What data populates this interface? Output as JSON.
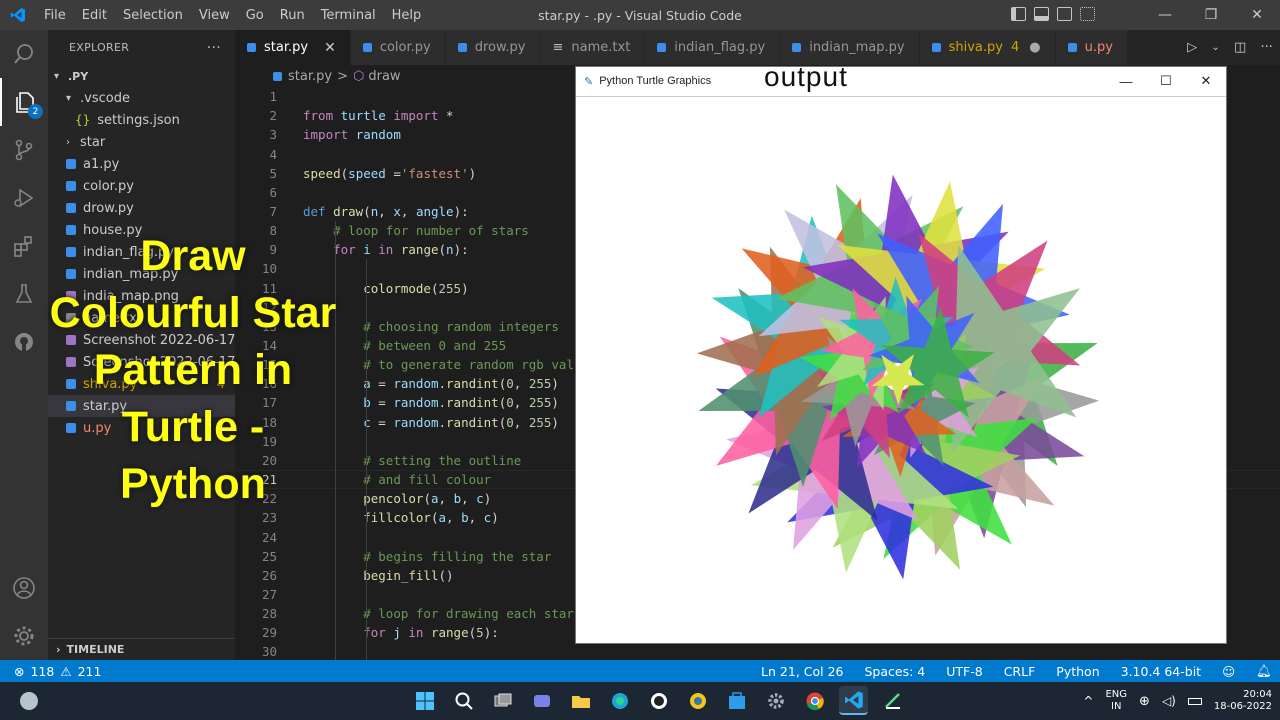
{
  "titlebar": {
    "menu": [
      "File",
      "Edit",
      "Selection",
      "View",
      "Go",
      "Run",
      "Terminal",
      "Help"
    ],
    "title": "star.py - .py - Visual Studio Code",
    "controls": {
      "minimize": "—",
      "maximize": "❐",
      "close": "✕"
    }
  },
  "activity": {
    "explorer_badge": "2"
  },
  "sidebar": {
    "header": "EXPLORER",
    "more": "···",
    "root": ".PY",
    "items": [
      {
        "label": ".vscode",
        "kind": "folder-open"
      },
      {
        "label": "settings.json",
        "kind": "json"
      },
      {
        "label": "star",
        "kind": "folder"
      },
      {
        "label": "a1.py",
        "kind": "py"
      },
      {
        "label": "color.py",
        "kind": "py"
      },
      {
        "label": "drow.py",
        "kind": "py"
      },
      {
        "label": "house.py",
        "kind": "py"
      },
      {
        "label": "indian_flag.py",
        "kind": "py"
      },
      {
        "label": "indian_map.py",
        "kind": "py"
      },
      {
        "label": "india_map.png",
        "kind": "img"
      },
      {
        "label": "name.txt",
        "kind": "txt"
      },
      {
        "label": "Screenshot 2022-06-17 ...",
        "kind": "img"
      },
      {
        "label": "Screenshot 2022-06-17 ...",
        "kind": "img"
      },
      {
        "label": "shiva.py",
        "kind": "py",
        "count": "4",
        "warn": true
      },
      {
        "label": "star.py",
        "kind": "py",
        "selected": true
      },
      {
        "label": "u.py",
        "kind": "py",
        "error": true
      }
    ],
    "timeline": "TIMELINE"
  },
  "tabs": [
    {
      "label": "star.py",
      "active": true,
      "close": "✕"
    },
    {
      "label": "color.py"
    },
    {
      "label": "drow.py"
    },
    {
      "label": "name.txt"
    },
    {
      "label": "indian_flag.py"
    },
    {
      "label": "indian_map.py"
    },
    {
      "label": "shiva.py",
      "count": "4"
    },
    {
      "label": "u.py"
    }
  ],
  "breadcrumb": {
    "file": "star.py",
    "sep": ">",
    "symbol": "draw"
  },
  "code": [
    {
      "n": "1",
      "html": ""
    },
    {
      "n": "2",
      "html": "<span class='kw'>from</span> <span class='va'>turtle</span> <span class='kw'>import</span> <span class='pl'>*</span>"
    },
    {
      "n": "3",
      "html": "<span class='kw'>import</span> <span class='va'>random</span>"
    },
    {
      "n": "4",
      "html": ""
    },
    {
      "n": "5",
      "html": "<span class='fn'>speed</span><span class='pl'>(</span><span class='va'>speed</span> <span class='pl'>=</span><span class='str'>'fastest'</span><span class='pl'>)</span>"
    },
    {
      "n": "6",
      "html": ""
    },
    {
      "n": "7",
      "html": "<span class='kw2'>def</span> <span class='fn'>draw</span><span class='pl'>(</span><span class='va'>n</span><span class='pl'>, </span><span class='va'>x</span><span class='pl'>, </span><span class='va'>angle</span><span class='pl'>):</span>"
    },
    {
      "n": "8",
      "html": "    <span class='cm'># loop for number of stars</span>"
    },
    {
      "n": "9",
      "html": "    <span class='kw'>for</span> <span class='va'>i</span> <span class='kw'>in</span> <span class='fn'>range</span><span class='pl'>(</span><span class='va'>n</span><span class='pl'>):</span>"
    },
    {
      "n": "10",
      "html": ""
    },
    {
      "n": "11",
      "html": "        <span class='fn'>colormode</span><span class='pl'>(</span><span class='num'>255</span><span class='pl'>)</span>"
    },
    {
      "n": "12",
      "html": ""
    },
    {
      "n": "13",
      "html": "        <span class='cm'># choosing random integers</span>"
    },
    {
      "n": "14",
      "html": "        <span class='cm'># between 0 and 255</span>"
    },
    {
      "n": "15",
      "html": "        <span class='cm'># to generate random rgb values</span>"
    },
    {
      "n": "16",
      "html": "        <span class='va'>a</span> <span class='pl'>=</span> <span class='va'>random</span><span class='pl'>.</span><span class='fn'>randint</span><span class='pl'>(</span><span class='num'>0</span><span class='pl'>, </span><span class='num'>255</span><span class='pl'>)</span>"
    },
    {
      "n": "17",
      "html": "        <span class='va'>b</span> <span class='pl'>=</span> <span class='va'>random</span><span class='pl'>.</span><span class='fn'>randint</span><span class='pl'>(</span><span class='num'>0</span><span class='pl'>, </span><span class='num'>255</span><span class='pl'>)</span>"
    },
    {
      "n": "18",
      "html": "        <span class='va'>c</span> <span class='pl'>=</span> <span class='va'>random</span><span class='pl'>.</span><span class='fn'>randint</span><span class='pl'>(</span><span class='num'>0</span><span class='pl'>, </span><span class='num'>255</span><span class='pl'>)</span>"
    },
    {
      "n": "19",
      "html": ""
    },
    {
      "n": "20",
      "html": "        <span class='cm'># setting the outline</span>"
    },
    {
      "n": "21",
      "html": "        <span class='cm'># and fill colour</span>",
      "current": true
    },
    {
      "n": "22",
      "html": "        <span class='fn'>pencolor</span><span class='pl'>(</span><span class='va'>a</span><span class='pl'>, </span><span class='va'>b</span><span class='pl'>, </span><span class='va'>c</span><span class='pl'>)</span>"
    },
    {
      "n": "23",
      "html": "        <span class='fn'>fillcolor</span><span class='pl'>(</span><span class='va'>a</span><span class='pl'>, </span><span class='va'>b</span><span class='pl'>, </span><span class='va'>c</span><span class='pl'>)</span>"
    },
    {
      "n": "24",
      "html": ""
    },
    {
      "n": "25",
      "html": "        <span class='cm'># begins filling the star</span>"
    },
    {
      "n": "26",
      "html": "        <span class='fn'>begin_fill</span><span class='pl'>()</span>"
    },
    {
      "n": "27",
      "html": ""
    },
    {
      "n": "28",
      "html": "        <span class='cm'># loop for drawing each star</span>"
    },
    {
      "n": "29",
      "html": "        <span class='kw'>for</span> <span class='va'>j</span> <span class='kw'>in</span> <span class='fn'>range</span><span class='pl'>(</span><span class='num'>5</span><span class='pl'>):</span>"
    },
    {
      "n": "30",
      "html": ""
    }
  ],
  "turtle_window": {
    "title": "Python Turtle Graphics",
    "output_label": "output",
    "controls": {
      "minimize": "—",
      "maximize": "☐",
      "close": "✕"
    }
  },
  "star_colors": [
    "#3cb044",
    "#9a9a9a",
    "#7a4a9a",
    "#c8a0a0",
    "#3fe03f",
    "#a0d060",
    "#3030e0",
    "#b0e080",
    "#e0a0e0",
    "#303090",
    "#ff60a0",
    "#509070",
    "#a07050",
    "#20c0c0",
    "#e06020",
    "#c0c0e0",
    "#60c060",
    "#8030c0",
    "#e0e040",
    "#4060ff",
    "#d04080",
    "#90c090"
  ],
  "overlay": [
    "Draw",
    "Colourful Star",
    "Pattern in",
    "Turtle -",
    "Python"
  ],
  "status": {
    "errors": "118",
    "warnings": "211",
    "position": "Ln 21, Col 26",
    "spaces": "Spaces: 4",
    "encoding": "UTF-8",
    "eol": "CRLF",
    "language": "Python",
    "interpreter": "3.10.4 64-bit"
  },
  "taskbar": {
    "lang_top": "ENG",
    "lang_bottom": "IN",
    "time": "20:04",
    "date": "18-06-2022"
  }
}
